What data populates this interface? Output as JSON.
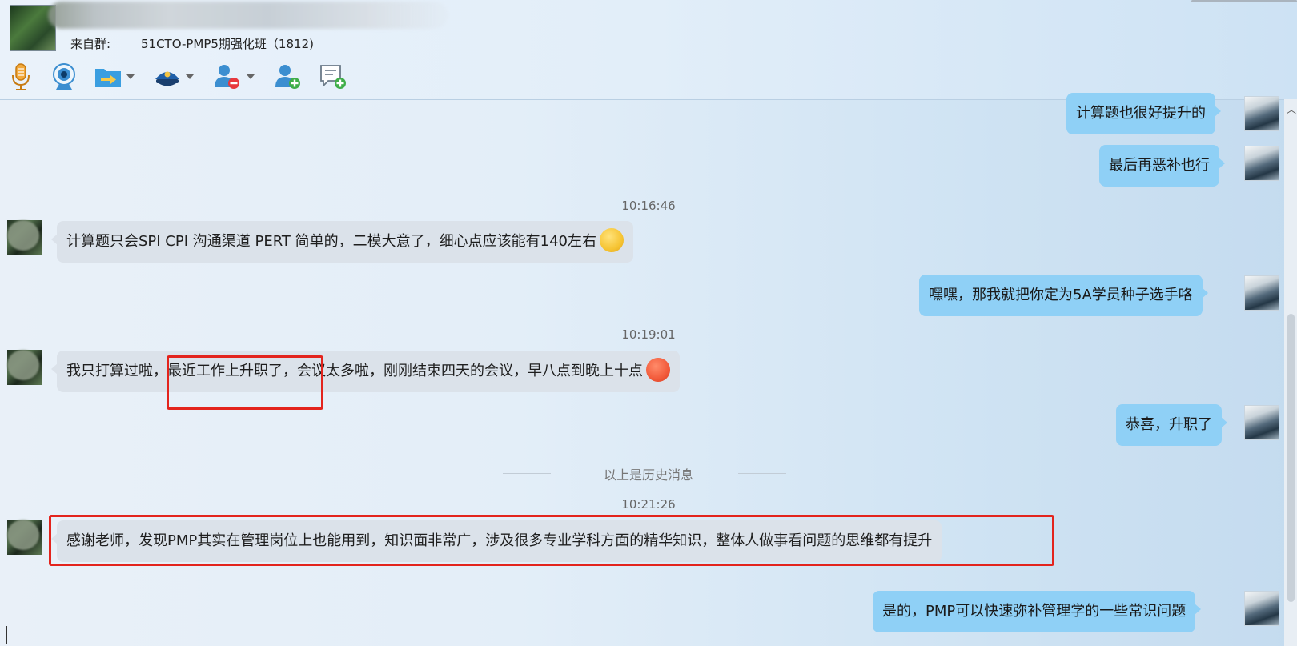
{
  "header": {
    "from_label": "来自群:",
    "group_name": "51CTO-PMP5期强化班（1812)"
  },
  "toolbar": {
    "icons": [
      "microphone-icon",
      "webcam-icon",
      "file-transfer-icon",
      "police-cap-icon",
      "remove-member-icon",
      "add-member-icon",
      "new-message-icon"
    ]
  },
  "messages": [
    {
      "id": "m1",
      "dir": "out",
      "text": "计算题也很好提升的"
    },
    {
      "id": "m2",
      "dir": "out",
      "text": "最后再恶补也行"
    },
    {
      "id": "t1",
      "type": "time",
      "text": "10:16:46"
    },
    {
      "id": "m3",
      "dir": "in",
      "text": "计算题只会SPI CPI  沟通渠道  PERT  简单的，二模大意了，细心点应该能有140左右",
      "emoji": "thinking-face"
    },
    {
      "id": "m4",
      "dir": "out",
      "text": "嘿嘿，那我就把你定为5A学员种子选手咯"
    },
    {
      "id": "t2",
      "type": "time",
      "text": "10:19:01"
    },
    {
      "id": "m5",
      "dir": "in",
      "text_a": "我只打算过啦，",
      "text_b": "最近工作上升职了，",
      "text_c": "会议太多啦，刚刚结束四天的会议，早八点到晚上十点",
      "emoji": "hot-face"
    },
    {
      "id": "m6",
      "dir": "out",
      "text": "恭喜，升职了"
    },
    {
      "id": "d1",
      "type": "divider",
      "text": "以上是历史消息"
    },
    {
      "id": "t3",
      "type": "time",
      "text": "10:21:26"
    },
    {
      "id": "m7",
      "dir": "in",
      "text": "感谢老师，发现PMP其实在管理岗位上也能用到，知识面非常广，涉及很多专业学科方面的精华知识，整体人做事看问题的思维都有提升"
    },
    {
      "id": "m8",
      "dir": "out",
      "text": "是的，PMP可以快速弥补管理学的一些常识问题"
    }
  ],
  "colors": {
    "incoming_bubble": "#dbe2ea",
    "outgoing_bubble": "#8fd0f6",
    "highlight": "#e3241d"
  }
}
